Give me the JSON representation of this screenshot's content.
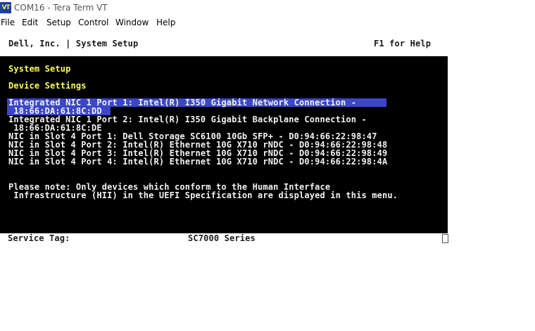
{
  "window": {
    "icon_text": "VT",
    "title": "COM16 - Tera Term VT"
  },
  "menu": {
    "file": "File",
    "edit": "Edit",
    "setup": "Setup",
    "control": "Control",
    "window": "Window",
    "help": "Help"
  },
  "terminal": {
    "header_left": "Dell, Inc. | System Setup",
    "header_right": "F1 for Help",
    "breadcrumb": "System Setup",
    "section_title": "Device Settings",
    "devices": [
      {
        "line1": "Integrated NIC 1 Port 1: Intel(R) I350 Gigabit Network Connection -",
        "line2": " 18:66:DA:61:8C:DD",
        "selected": true
      },
      {
        "line1": "Integrated NIC 1 Port 2: Intel(R) I350 Gigabit Backplane Connection -",
        "line2": " 18:66:DA:61:8C:DE",
        "selected": false
      },
      {
        "line1": "NIC in Slot 4 Port 1: Dell Storage SC6100 10Gb SFP+ - D0:94:66:22:98:47",
        "selected": false
      },
      {
        "line1": "NIC in Slot 4 Port 2: Intel(R) Ethernet 10G X710 rNDC - D0:94:66:22:98:48",
        "selected": false
      },
      {
        "line1": "NIC in Slot 4 Port 3: Intel(R) Ethernet 10G X710 rNDC - D0:94:66:22:98:49",
        "selected": false
      },
      {
        "line1": "NIC in Slot 4 Port 4: Intel(R) Ethernet 10G X710 rNDC - D0:94:66:22:98:4A",
        "selected": false
      }
    ],
    "note_line1": "Please note: Only devices which conform to the Human Interface",
    "note_line2": " Infrastructure (HII) in the UEFI Specification are displayed in this menu.",
    "service_tag_label": "Service Tag:",
    "model": "SC7000 Series"
  },
  "colors": {
    "selection": "#3c46c8",
    "heading": "#ffff54",
    "panel": "#000000",
    "text": "#f2f2f2"
  }
}
